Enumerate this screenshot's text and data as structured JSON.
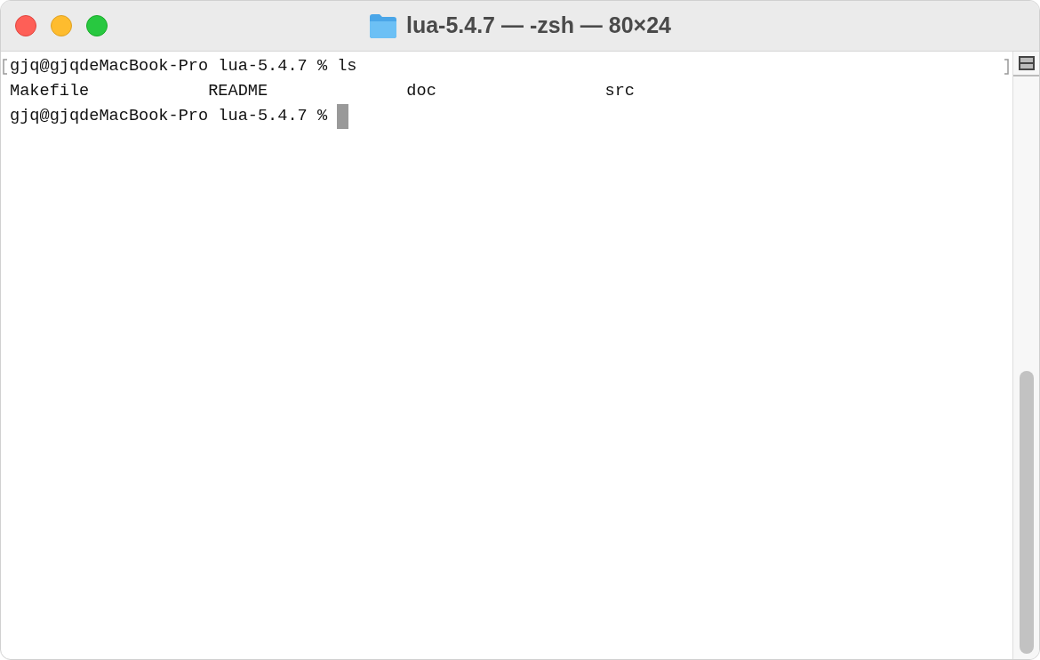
{
  "window": {
    "title": "lua-5.4.7 — -zsh — 80×24"
  },
  "lines": [
    {
      "kind": "prompt",
      "text": "gjq@gjqdeMacBook-Pro lua-5.4.7 % ls",
      "cursor": false
    },
    {
      "kind": "listing",
      "items": [
        "Makefile",
        "README",
        "doc",
        "src"
      ]
    },
    {
      "kind": "prompt",
      "text": "gjq@gjqdeMacBook-Pro lua-5.4.7 %",
      "cursor": true
    }
  ]
}
